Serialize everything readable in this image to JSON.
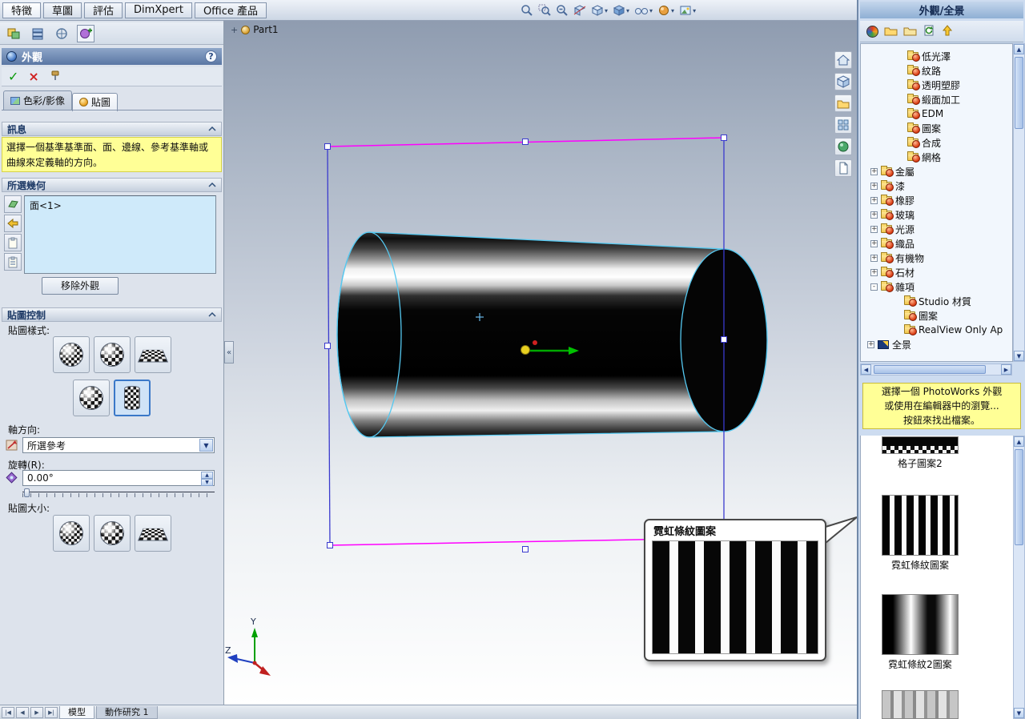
{
  "colors": {
    "selection_magenta": "#ff00ff",
    "selection_blue": "#3a3ace",
    "highlight_blue": "#55c8f0",
    "message_yellow": "#ffff96"
  },
  "icons": {
    "caret": "▾",
    "dropdown": "▼",
    "spin_up": "▲",
    "spin_down": "▼",
    "up": "▲",
    "down": "▼",
    "left": "◀",
    "right": "▶",
    "check": "✓",
    "cancel": "×",
    "help": "?",
    "plus": "+",
    "collapse": "«"
  },
  "menubar": {
    "tabs": [
      {
        "label": "特徵"
      },
      {
        "label": "草圖"
      },
      {
        "label": "評估"
      },
      {
        "label": "DimXpert"
      },
      {
        "label": "Office 產品"
      }
    ]
  },
  "property_panel": {
    "title": "外觀",
    "tabs": [
      {
        "label": "色彩/影像"
      },
      {
        "label": "貼圖"
      }
    ],
    "message_header": "訊息",
    "message_line1": "選擇一個基準基準面、面、邊線、參考基準軸或",
    "message_line2": "曲線來定義軸的方向。",
    "geometry_header": "所選幾何",
    "geometry_item": "面<1>",
    "remove_button": "移除外觀",
    "decal_header": "貼圖控制",
    "style_label": "貼圖樣式:",
    "axis_label": "軸方向:",
    "axis_value": "所選參考",
    "rotate_label": "旋轉(R):",
    "rotate_value": "0.00°",
    "size_label": "貼圖大小:"
  },
  "viewport": {
    "part_label": "Part1",
    "triad_y": "Y",
    "triad_z": "Z",
    "callout_title": "霓虹條紋圖案"
  },
  "task_pane": {
    "title": "外觀/全景",
    "tree": [
      {
        "label": "低光澤"
      },
      {
        "label": "紋路"
      },
      {
        "label": "透明塑膠"
      },
      {
        "label": "緞面加工"
      },
      {
        "label": "EDM"
      },
      {
        "label": "圖案"
      },
      {
        "label": "合成"
      },
      {
        "label": "網格"
      },
      {
        "label": "金屬",
        "expand": "+"
      },
      {
        "label": "漆",
        "expand": "+"
      },
      {
        "label": "橡膠",
        "expand": "+"
      },
      {
        "label": "玻璃",
        "expand": "+"
      },
      {
        "label": "光源",
        "expand": "+"
      },
      {
        "label": "織品",
        "expand": "+"
      },
      {
        "label": "有機物",
        "expand": "+"
      },
      {
        "label": "石材",
        "expand": "+"
      },
      {
        "label": "雜項",
        "expand": "-"
      },
      {
        "label": "Studio 材質"
      },
      {
        "label": "圖案"
      },
      {
        "label": "RealView Only Ap"
      },
      {
        "label": "全景",
        "expand": "+"
      }
    ],
    "message_line1": "選擇一個 PhotoWorks 外觀",
    "message_line2": "或使用在編輯器中的瀏覽...",
    "message_line3": "按鈕來找出檔案。",
    "previews": [
      {
        "label": "格子圖案2"
      },
      {
        "label": "霓虹條紋圖案"
      },
      {
        "label": "霓虹條紋2圖案"
      }
    ]
  },
  "statusbar": {
    "nav": [
      "|◀",
      "◀",
      "▶",
      "▶|"
    ],
    "tabs": [
      {
        "label": "模型"
      },
      {
        "label": "動作研究 1"
      }
    ]
  }
}
